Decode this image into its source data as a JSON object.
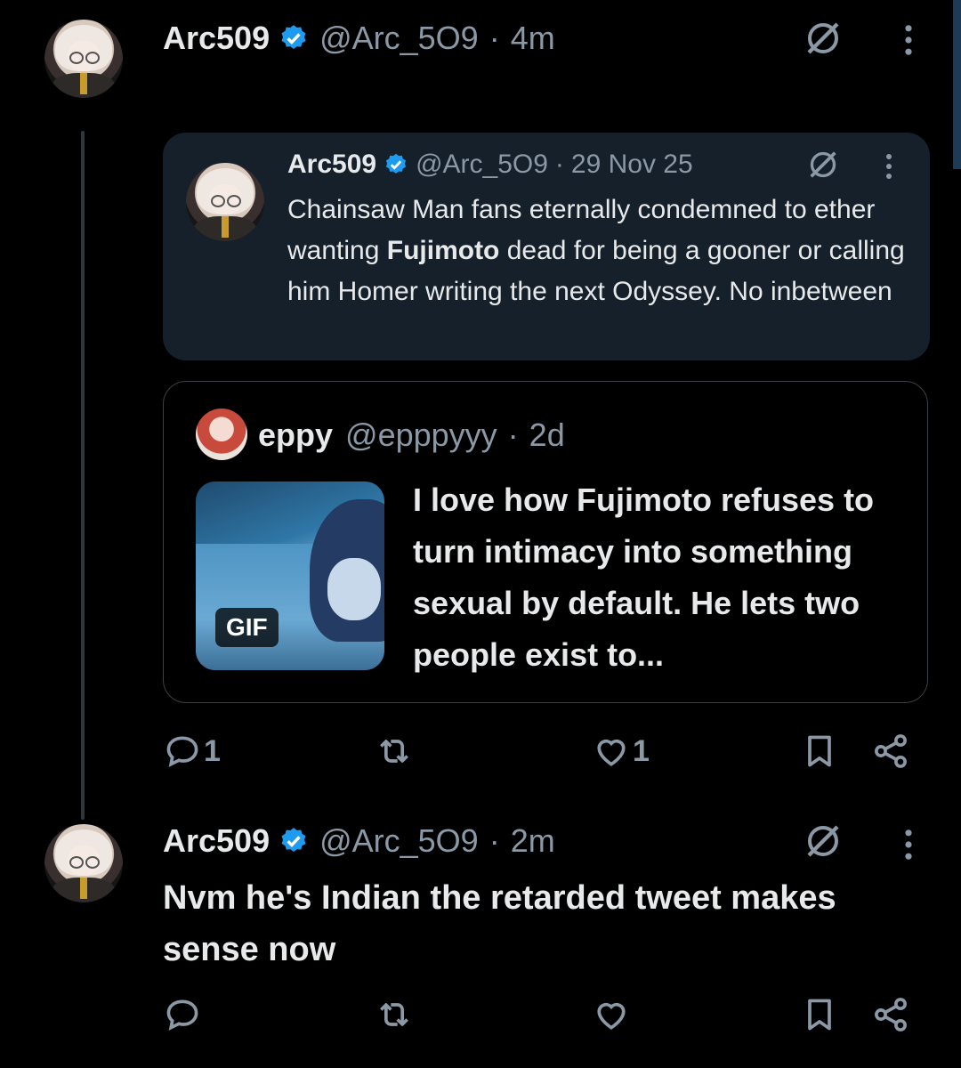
{
  "tweets": [
    {
      "author": {
        "name": "Arc509",
        "handle": "@Arc_5O9",
        "time": "4m"
      },
      "quoted_main": {
        "author": {
          "name": "Arc509",
          "handle": "@Arc_5O9",
          "time": "29 Nov 25"
        },
        "text_before": "Chainsaw Man fans eternally condemned to ether wanting ",
        "text_bold": "Fujimoto",
        "text_after": " dead for being a gooner or calling him Homer writing the next Odyssey. No inbetween"
      },
      "quoted_sub": {
        "author": {
          "name": "eppy",
          "handle": "@epppyyy",
          "time": "2d"
        },
        "media_label": "GIF",
        "text": "I love how Fujimoto refuses to turn intimacy into something sexual by default. He lets two people exist to..."
      },
      "stats": {
        "replies": "1",
        "reposts": "",
        "likes": "1"
      }
    },
    {
      "author": {
        "name": "Arc509",
        "handle": "@Arc_5O9",
        "time": "2m"
      },
      "text": "Nvm he's Indian the retarded tweet makes sense now",
      "stats": {
        "replies": "",
        "reposts": "",
        "likes": ""
      }
    }
  ],
  "separator": "·",
  "colors": {
    "background": "#000000",
    "text": "#e7e9ea",
    "muted": "#8b98a5",
    "verified": "#1d9bf0",
    "quote_bg": "#15202b"
  },
  "icons": [
    "verified-badge-icon",
    "grok-icon",
    "more-vert-icon",
    "reply-icon",
    "repost-icon",
    "like-icon",
    "bookmark-icon",
    "share-icon"
  ]
}
